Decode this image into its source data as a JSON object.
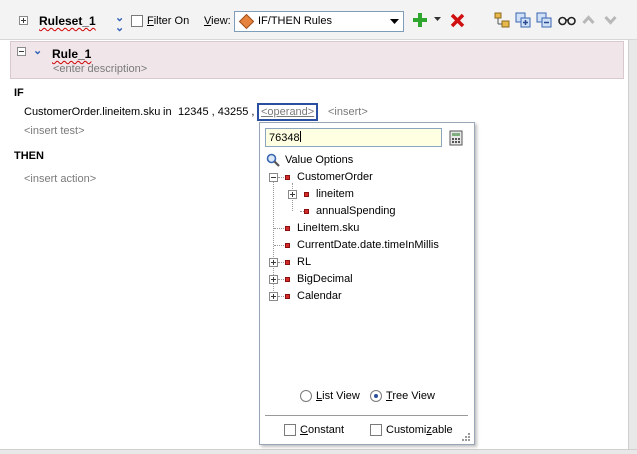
{
  "toolbar": {
    "ruleset_name": "Ruleset_1",
    "filter_label_u": "F",
    "filter_label_rest": "ilter On",
    "view_label_u": "V",
    "view_label_rest": "iew:",
    "view_value": "IF/THEN Rules",
    "icons": [
      "expand-collapse-icon",
      "chevron-double-down-icon",
      "add-icon",
      "dropdown-arrow-icon",
      "delete-icon",
      "tree-icon",
      "add-bucket-icon",
      "remove-bucket-icon",
      "glasses-icon",
      "move-up-icon",
      "move-down-icon"
    ]
  },
  "rule": {
    "name": "Rule_1",
    "description_placeholder": "<enter description>"
  },
  "if_section": {
    "label": "IF",
    "test_lhs": "CustomerOrder.lineitem.sku",
    "operator": "in",
    "values": "12345 , 43255 ,",
    "operand_link": "<operand>",
    "insert_link": "<insert>",
    "insert_test": "<insert test>"
  },
  "then_section": {
    "label": "THEN",
    "insert_action": "<insert action>"
  },
  "popup": {
    "input_value": "76348",
    "value_options_label": "Value Options",
    "tree": [
      {
        "label": "CustomerOrder",
        "expander": "minus"
      },
      {
        "label": "lineitem",
        "expander": "plus"
      },
      {
        "label": "annualSpending",
        "expander": "none"
      },
      {
        "label": "LineItem.sku",
        "expander": "none"
      },
      {
        "label": "CurrentDate.date.timeInMillis",
        "expander": "none"
      },
      {
        "label": "RL",
        "expander": "plus"
      },
      {
        "label": "BigDecimal",
        "expander": "plus"
      },
      {
        "label": "Calendar",
        "expander": "plus"
      }
    ],
    "list_view_u": "L",
    "list_view_rest": "ist View",
    "tree_view_u": "T",
    "tree_view_rest": "ree View",
    "selected_view": "Tree View",
    "constant_label_u": "C",
    "constant_label_rest": "onstant",
    "customizable_label_pre": "Customi",
    "customizable_label_u": "z",
    "customizable_label_rest": "able"
  },
  "colors": {
    "accent": "#3060b8",
    "rule_header_bg": "#f0e6ea",
    "input_bg": "#ffffe1",
    "delete_red": "#d01010",
    "add_green": "#22a022"
  }
}
